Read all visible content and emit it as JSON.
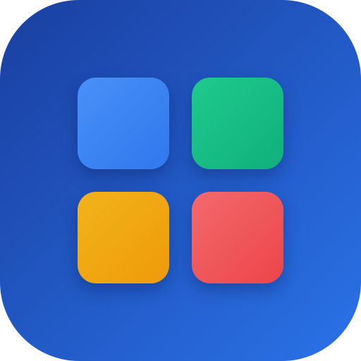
{
  "icon": {
    "name": "app-grid-icon",
    "background": {
      "gradient_start": "#1a3fa0",
      "gradient_end": "#2a72e8"
    },
    "tiles": [
      {
        "name": "blue-tile",
        "color_start": "#4a90f7",
        "color_end": "#2f78ee"
      },
      {
        "name": "green-tile",
        "color_start": "#1fc98e",
        "color_end": "#10b07a"
      },
      {
        "name": "orange-tile",
        "color_start": "#f2b31a",
        "color_end": "#ee9a0a"
      },
      {
        "name": "red-tile",
        "color_start": "#f26a6e",
        "color_end": "#ec4548"
      }
    ]
  }
}
